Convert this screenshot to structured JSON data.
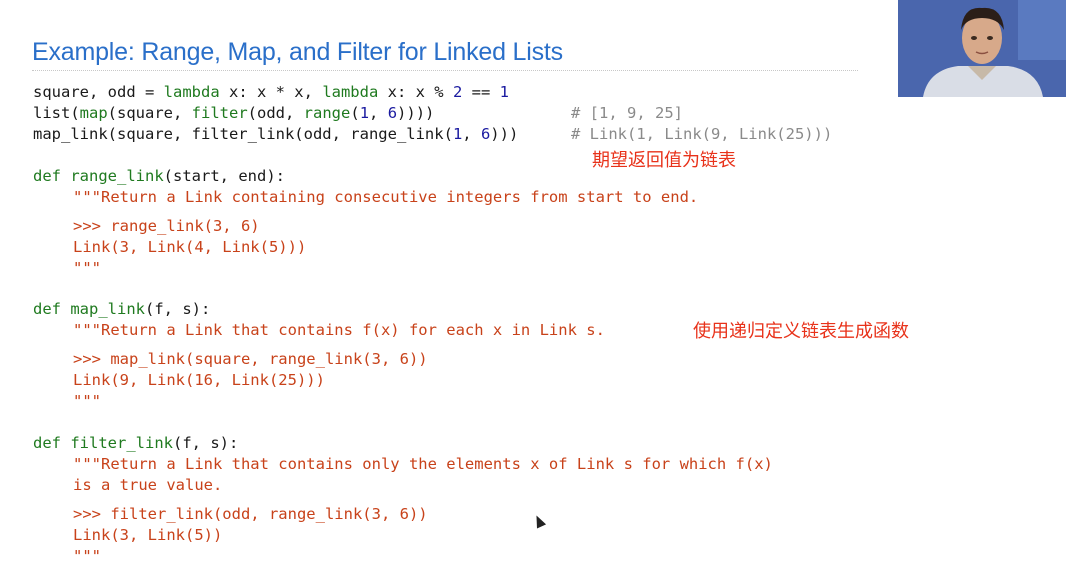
{
  "title": "Example: Range, Map, and Filter for Linked Lists",
  "code": {
    "l1": {
      "a": "square, odd = ",
      "b": "lambda",
      "c": " x: x * x, ",
      "d": "lambda",
      "e": " x: x % ",
      "f": "2",
      "g": " == ",
      "h": "1"
    },
    "l2": {
      "a": "list(",
      "b": "map",
      "c": "(square, ",
      "d": "filter",
      "e": "(odd, ",
      "f": "range",
      "g": "(",
      "h": "1",
      ",": ", ",
      "i": "6",
      "j": "))))",
      "k": "# [1, 9, 25]"
    },
    "l3": {
      "a": "map_link(square, filter_link(odd, range_link(",
      "b": "1",
      "c": ", ",
      "d": "6",
      "e": ")))",
      "f": "# Link(1, Link(9, Link(25)))"
    },
    "l4": {
      "a": "def",
      "b": " ",
      "c": "range_link",
      "d": "(start, end):"
    },
    "l5": "\"\"\"Return a Link containing consecutive integers from start to end.",
    "l6": ">>> range_link(3, 6)",
    "l7": "Link(3, Link(4, Link(5)))",
    "l8": "\"\"\"",
    "l9": {
      "a": "def",
      "b": " ",
      "c": "map_link",
      "d": "(f, s):"
    },
    "l10": "\"\"\"Return a Link that contains f(x) for each x in Link s.",
    "l11": ">>> map_link(square, range_link(3, 6))",
    "l12": "Link(9, Link(16, Link(25)))",
    "l13": "\"\"\"",
    "l14": {
      "a": "def",
      "b": " ",
      "c": "filter_link",
      "d": "(f, s):"
    },
    "l15": "\"\"\"Return a Link that contains only the elements x of Link s for which f(x)",
    "l16": "is a true value.",
    "l17": ">>> filter_link(odd, range_link(3, 6))",
    "l18": "Link(3, Link(5))",
    "l19": "\"\"\""
  },
  "annotations": {
    "a1": "期望返回值为链表",
    "a2": "使用递归定义链表生成函数"
  },
  "colors": {
    "title": "#2a6fc9",
    "keyword": "#1f7a1f",
    "number": "#1a1aa0",
    "docstring": "#c8421a",
    "comment": "#8a8a8a",
    "annotation": "#e8321a"
  }
}
